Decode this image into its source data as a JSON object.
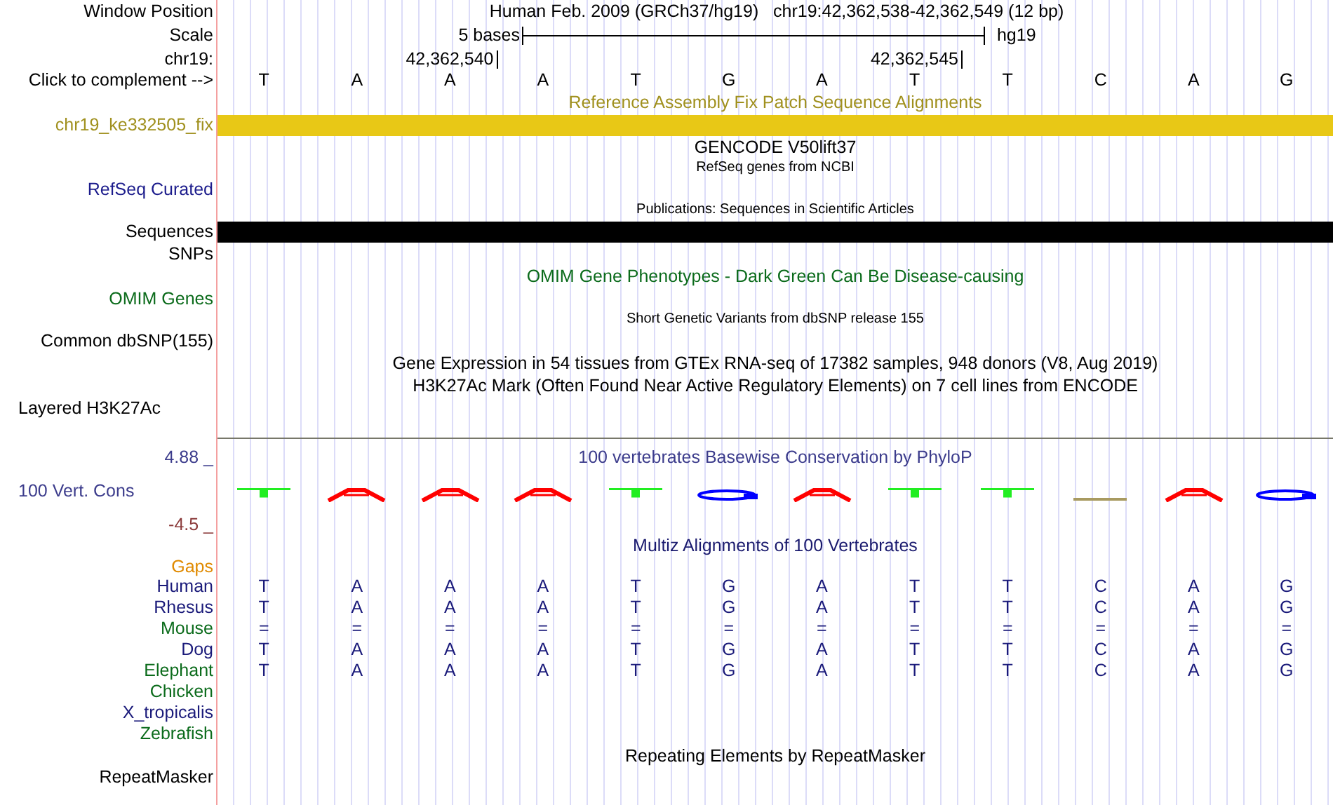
{
  "header": {
    "position_label": "Window Position",
    "position_text": "Human Feb. 2009 (GRCh37/hg19)   chr19:42,362,538-42,362,549 (12 bp)",
    "scale_label": "Scale",
    "scale_text": "5 bases",
    "assembly": "hg19",
    "chrom_label": "chr19:",
    "complement_label": "Click to complement -->"
  },
  "bases": [
    {
      "letter": "T"
    },
    {
      "letter": "A"
    },
    {
      "letter": "A",
      "coordinate": "42,362,540"
    },
    {
      "letter": "A"
    },
    {
      "letter": "T"
    },
    {
      "letter": "G"
    },
    {
      "letter": "A"
    },
    {
      "letter": "T",
      "coordinate": "42,362,545"
    },
    {
      "letter": "T"
    },
    {
      "letter": "C"
    },
    {
      "letter": "A"
    },
    {
      "letter": "G"
    }
  ],
  "rows": [
    {
      "kind": "title",
      "text": "Reference Assembly Fix Patch Sequence Alignments",
      "color": "#a0901e"
    },
    {
      "kind": "patch",
      "label": "chr19_ke332505_fix",
      "color": "#e8c816"
    },
    {
      "kind": "title",
      "text": "GENCODE V50lift37",
      "color": "#000000"
    },
    {
      "kind": "subtitle",
      "text": "RefSeq genes from NCBI"
    },
    {
      "kind": "label",
      "label": "RefSeq Curated",
      "color": "#1c1c8c"
    },
    {
      "kind": "subtitle",
      "text": "Publications: Sequences in Scientific Articles"
    },
    {
      "kind": "bar",
      "label": "Sequences",
      "color": "#000000"
    },
    {
      "kind": "label",
      "label": "SNPs",
      "color": "#000000"
    },
    {
      "kind": "title",
      "text": "OMIM Gene Phenotypes - Dark Green Can Be Disease-causing",
      "color": "#0b6b1b"
    },
    {
      "kind": "label",
      "label": "OMIM Genes",
      "color": "#0b6b1b"
    },
    {
      "kind": "subtitle",
      "text": "Short Genetic Variants from dbSNP release 155"
    },
    {
      "kind": "label",
      "label": "Common dbSNP(155)",
      "color": "#000000"
    },
    {
      "kind": "title",
      "text": "Gene Expression in 54 tissues from GTEx RNA-seq of 17382 samples, 948 donors (V8, Aug 2019)",
      "color": "#000000"
    },
    {
      "kind": "title",
      "text": "H3K27Ac Mark (Often Found Near Active Regulatory Elements) on 7 cell lines from ENCODE",
      "color": "#000000"
    },
    {
      "kind": "side_label",
      "label": "Layered H3K27Ac",
      "color": "#000000"
    },
    {
      "kind": "divider"
    },
    {
      "kind": "title",
      "text": "100 vertebrates Basewise Conservation by PhyloP",
      "color": "#3c3c8c",
      "label": "4.88 _"
    },
    {
      "kind": "logo",
      "label": "100 Vert. Cons",
      "color": "#3c3c8c"
    },
    {
      "kind": "axis",
      "label": "-4.5 _",
      "color": "#8b3a3a"
    },
    {
      "kind": "title",
      "text": "Multiz Alignments of 100 Vertebrates",
      "color": "#1a1a6e"
    },
    {
      "kind": "axis",
      "label": "Gaps",
      "color": "#e08a00"
    },
    {
      "kind": "species",
      "label": "Human",
      "color": "#1a1a7a",
      "bases": [
        "T",
        "A",
        "A",
        "A",
        "T",
        "G",
        "A",
        "T",
        "T",
        "C",
        "A",
        "G"
      ]
    },
    {
      "kind": "species",
      "label": "Rhesus",
      "color": "#1a1a7a",
      "bases": [
        "T",
        "A",
        "A",
        "A",
        "T",
        "G",
        "A",
        "T",
        "T",
        "C",
        "A",
        "G"
      ]
    },
    {
      "kind": "species",
      "label": "Mouse",
      "color": "#0b6b1b",
      "bases": [
        "=",
        "=",
        "=",
        "=",
        "=",
        "=",
        "=",
        "=",
        "=",
        "=",
        "=",
        "="
      ]
    },
    {
      "kind": "species",
      "label": "Dog",
      "color": "#1a1a7a",
      "bases": [
        "T",
        "A",
        "A",
        "A",
        "T",
        "G",
        "A",
        "T",
        "T",
        "C",
        "A",
        "G"
      ]
    },
    {
      "kind": "species",
      "label": "Elephant",
      "color": "#0b6b1b",
      "bases": [
        "T",
        "A",
        "A",
        "A",
        "T",
        "G",
        "A",
        "T",
        "T",
        "C",
        "A",
        "G"
      ]
    },
    {
      "kind": "species",
      "label": "Chicken",
      "color": "#0b6b1b"
    },
    {
      "kind": "species",
      "label": "X_tropicalis",
      "color": "#1a1a7a"
    },
    {
      "kind": "species",
      "label": "Zebrafish",
      "color": "#0b6b1b"
    },
    {
      "kind": "title",
      "text": "Repeating Elements by RepeatMasker",
      "color": "#000000"
    },
    {
      "kind": "axis",
      "label": "RepeatMasker",
      "color": "#000000"
    }
  ]
}
